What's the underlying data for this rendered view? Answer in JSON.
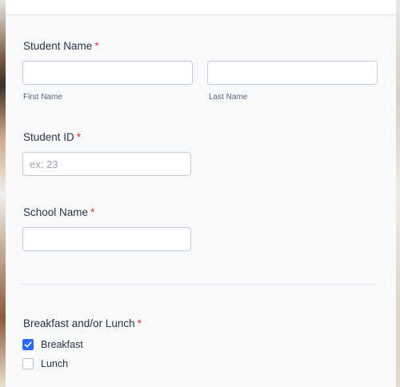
{
  "form": {
    "student_name": {
      "label": "Student Name",
      "required_mark": "*",
      "first": {
        "value": "",
        "sublabel": "First Name"
      },
      "last": {
        "value": "",
        "sublabel": "Last Name"
      }
    },
    "student_id": {
      "label": "Student ID",
      "required_mark": "*",
      "placeholder": "ex: 23",
      "value": ""
    },
    "school_name": {
      "label": "School Name",
      "required_mark": "*",
      "value": ""
    },
    "meals": {
      "label": "Breakfast and/or Lunch",
      "required_mark": "*",
      "options": [
        {
          "label": "Breakfast",
          "checked": true
        },
        {
          "label": "Lunch",
          "checked": false
        }
      ]
    }
  },
  "colors": {
    "accent": "#2e69ff",
    "required": "#e02f2f",
    "text": "#2c3345"
  }
}
